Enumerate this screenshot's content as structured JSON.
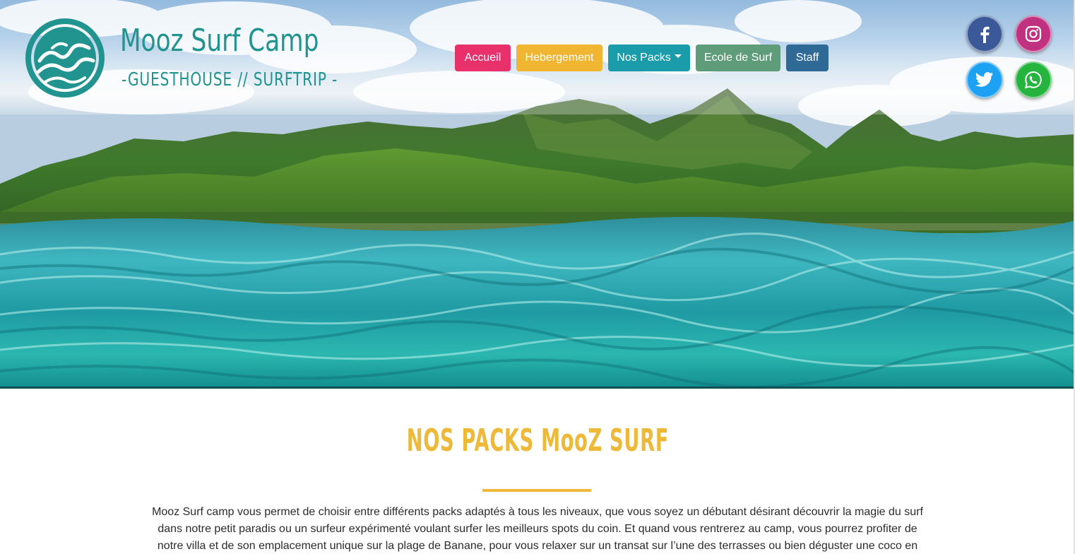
{
  "brand": {
    "name": "Mooz Surf Camp",
    "tagline": "-GUESTHOUSE // SURFTRIP -",
    "color": "#21948f"
  },
  "nav": {
    "items": [
      {
        "label": "Accueil",
        "color": "#e8306a"
      },
      {
        "label": "Hebergement",
        "color": "#f0b531"
      },
      {
        "label": "Nos Packs",
        "color": "#1a9caa",
        "dropdown": true
      },
      {
        "label": "Ecole de Surf",
        "color": "#5e9c7a"
      },
      {
        "label": "Staff",
        "color": "#2f6a96"
      }
    ]
  },
  "social": [
    {
      "network": "facebook",
      "icon": "facebook-icon",
      "color": "#3b5998"
    },
    {
      "network": "instagram",
      "icon": "instagram-icon",
      "color": "#c0317f"
    },
    {
      "network": "twitter",
      "icon": "twitter-icon",
      "color": "#1da1f2"
    },
    {
      "network": "whatsapp",
      "icon": "whatsapp-icon",
      "color": "#25b53e"
    }
  ],
  "section": {
    "title": "NOS PACKS MooZ SURF",
    "accent": "#eeb839",
    "intro": "Mooz Surf camp vous permet de choisir entre différents packs adaptés à tous les niveaux, que vous soyez un débutant désirant découvrir la magie du surf dans notre petit paradis ou un surfeur expérimenté voulant surfer les meilleurs spots du coin. Et quand vous rentrerez au camp, vous pourrez profiter de notre villa et de son emplacement unique sur la plage de Banane, pour vous relaxer sur un transat sur l’une des terrasses ou bien déguster une coco en"
  }
}
